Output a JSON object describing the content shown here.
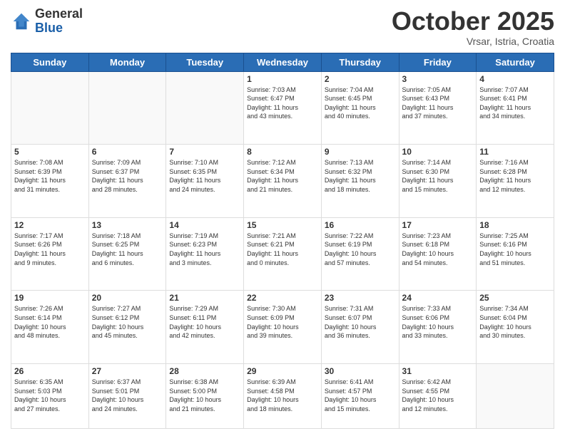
{
  "header": {
    "logo_line1": "General",
    "logo_line2": "Blue",
    "month": "October 2025",
    "location": "Vrsar, Istria, Croatia"
  },
  "days_of_week": [
    "Sunday",
    "Monday",
    "Tuesday",
    "Wednesday",
    "Thursday",
    "Friday",
    "Saturday"
  ],
  "weeks": [
    [
      {
        "day": "",
        "info": ""
      },
      {
        "day": "",
        "info": ""
      },
      {
        "day": "",
        "info": ""
      },
      {
        "day": "1",
        "info": "Sunrise: 7:03 AM\nSunset: 6:47 PM\nDaylight: 11 hours\nand 43 minutes."
      },
      {
        "day": "2",
        "info": "Sunrise: 7:04 AM\nSunset: 6:45 PM\nDaylight: 11 hours\nand 40 minutes."
      },
      {
        "day": "3",
        "info": "Sunrise: 7:05 AM\nSunset: 6:43 PM\nDaylight: 11 hours\nand 37 minutes."
      },
      {
        "day": "4",
        "info": "Sunrise: 7:07 AM\nSunset: 6:41 PM\nDaylight: 11 hours\nand 34 minutes."
      }
    ],
    [
      {
        "day": "5",
        "info": "Sunrise: 7:08 AM\nSunset: 6:39 PM\nDaylight: 11 hours\nand 31 minutes."
      },
      {
        "day": "6",
        "info": "Sunrise: 7:09 AM\nSunset: 6:37 PM\nDaylight: 11 hours\nand 28 minutes."
      },
      {
        "day": "7",
        "info": "Sunrise: 7:10 AM\nSunset: 6:35 PM\nDaylight: 11 hours\nand 24 minutes."
      },
      {
        "day": "8",
        "info": "Sunrise: 7:12 AM\nSunset: 6:34 PM\nDaylight: 11 hours\nand 21 minutes."
      },
      {
        "day": "9",
        "info": "Sunrise: 7:13 AM\nSunset: 6:32 PM\nDaylight: 11 hours\nand 18 minutes."
      },
      {
        "day": "10",
        "info": "Sunrise: 7:14 AM\nSunset: 6:30 PM\nDaylight: 11 hours\nand 15 minutes."
      },
      {
        "day": "11",
        "info": "Sunrise: 7:16 AM\nSunset: 6:28 PM\nDaylight: 11 hours\nand 12 minutes."
      }
    ],
    [
      {
        "day": "12",
        "info": "Sunrise: 7:17 AM\nSunset: 6:26 PM\nDaylight: 11 hours\nand 9 minutes."
      },
      {
        "day": "13",
        "info": "Sunrise: 7:18 AM\nSunset: 6:25 PM\nDaylight: 11 hours\nand 6 minutes."
      },
      {
        "day": "14",
        "info": "Sunrise: 7:19 AM\nSunset: 6:23 PM\nDaylight: 11 hours\nand 3 minutes."
      },
      {
        "day": "15",
        "info": "Sunrise: 7:21 AM\nSunset: 6:21 PM\nDaylight: 11 hours\nand 0 minutes."
      },
      {
        "day": "16",
        "info": "Sunrise: 7:22 AM\nSunset: 6:19 PM\nDaylight: 10 hours\nand 57 minutes."
      },
      {
        "day": "17",
        "info": "Sunrise: 7:23 AM\nSunset: 6:18 PM\nDaylight: 10 hours\nand 54 minutes."
      },
      {
        "day": "18",
        "info": "Sunrise: 7:25 AM\nSunset: 6:16 PM\nDaylight: 10 hours\nand 51 minutes."
      }
    ],
    [
      {
        "day": "19",
        "info": "Sunrise: 7:26 AM\nSunset: 6:14 PM\nDaylight: 10 hours\nand 48 minutes."
      },
      {
        "day": "20",
        "info": "Sunrise: 7:27 AM\nSunset: 6:12 PM\nDaylight: 10 hours\nand 45 minutes."
      },
      {
        "day": "21",
        "info": "Sunrise: 7:29 AM\nSunset: 6:11 PM\nDaylight: 10 hours\nand 42 minutes."
      },
      {
        "day": "22",
        "info": "Sunrise: 7:30 AM\nSunset: 6:09 PM\nDaylight: 10 hours\nand 39 minutes."
      },
      {
        "day": "23",
        "info": "Sunrise: 7:31 AM\nSunset: 6:07 PM\nDaylight: 10 hours\nand 36 minutes."
      },
      {
        "day": "24",
        "info": "Sunrise: 7:33 AM\nSunset: 6:06 PM\nDaylight: 10 hours\nand 33 minutes."
      },
      {
        "day": "25",
        "info": "Sunrise: 7:34 AM\nSunset: 6:04 PM\nDaylight: 10 hours\nand 30 minutes."
      }
    ],
    [
      {
        "day": "26",
        "info": "Sunrise: 6:35 AM\nSunset: 5:03 PM\nDaylight: 10 hours\nand 27 minutes."
      },
      {
        "day": "27",
        "info": "Sunrise: 6:37 AM\nSunset: 5:01 PM\nDaylight: 10 hours\nand 24 minutes."
      },
      {
        "day": "28",
        "info": "Sunrise: 6:38 AM\nSunset: 5:00 PM\nDaylight: 10 hours\nand 21 minutes."
      },
      {
        "day": "29",
        "info": "Sunrise: 6:39 AM\nSunset: 4:58 PM\nDaylight: 10 hours\nand 18 minutes."
      },
      {
        "day": "30",
        "info": "Sunrise: 6:41 AM\nSunset: 4:57 PM\nDaylight: 10 hours\nand 15 minutes."
      },
      {
        "day": "31",
        "info": "Sunrise: 6:42 AM\nSunset: 4:55 PM\nDaylight: 10 hours\nand 12 minutes."
      },
      {
        "day": "",
        "info": ""
      }
    ]
  ]
}
